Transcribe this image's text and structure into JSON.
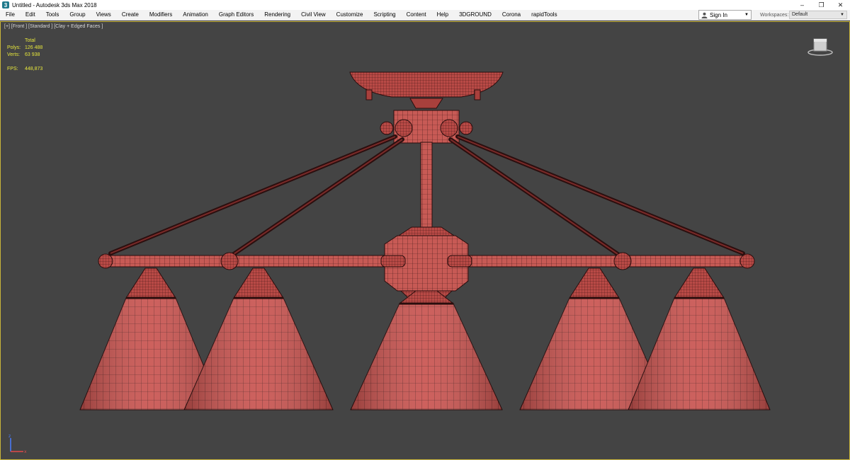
{
  "window": {
    "title": "Untitled - Autodesk 3ds Max 2018",
    "app_icon_glyph": "3",
    "controls": {
      "minimize": "–",
      "restore": "❐",
      "close": "✕"
    }
  },
  "menu": {
    "items": [
      "File",
      "Edit",
      "Tools",
      "Group",
      "Views",
      "Create",
      "Modifiers",
      "Animation",
      "Graph Editors",
      "Rendering",
      "Civil View",
      "Customize",
      "Scripting",
      "Content",
      "Help",
      "3DGROUND",
      "Corona",
      "rapidTools"
    ],
    "sign_in": "Sign In",
    "workspaces_label": "Workspaces:",
    "workspace_value": "Default"
  },
  "viewport": {
    "label": "[+] [Front ] [Standard ] [Clay + Edged Faces ]",
    "stats": {
      "total_label": "Total",
      "polys_label": "Polys:",
      "polys_value": "126 488",
      "verts_label": "Verts:",
      "verts_value": "63 938",
      "fps_label": "FPS:",
      "fps_value": "448,873"
    }
  },
  "icons": {
    "app": "3dsmax-app-icon",
    "user": "user-icon",
    "dropdown": "chevron-down-icon",
    "viewcube": "viewcube-icon",
    "axis": "axis-gizmo-icon"
  },
  "colors": {
    "viewport_bg": "#444444",
    "model_fill": "#c0504d",
    "model_edge": "#3a1515",
    "stats_text": "#e6e63c",
    "viewport_border": "#c9b53a"
  }
}
